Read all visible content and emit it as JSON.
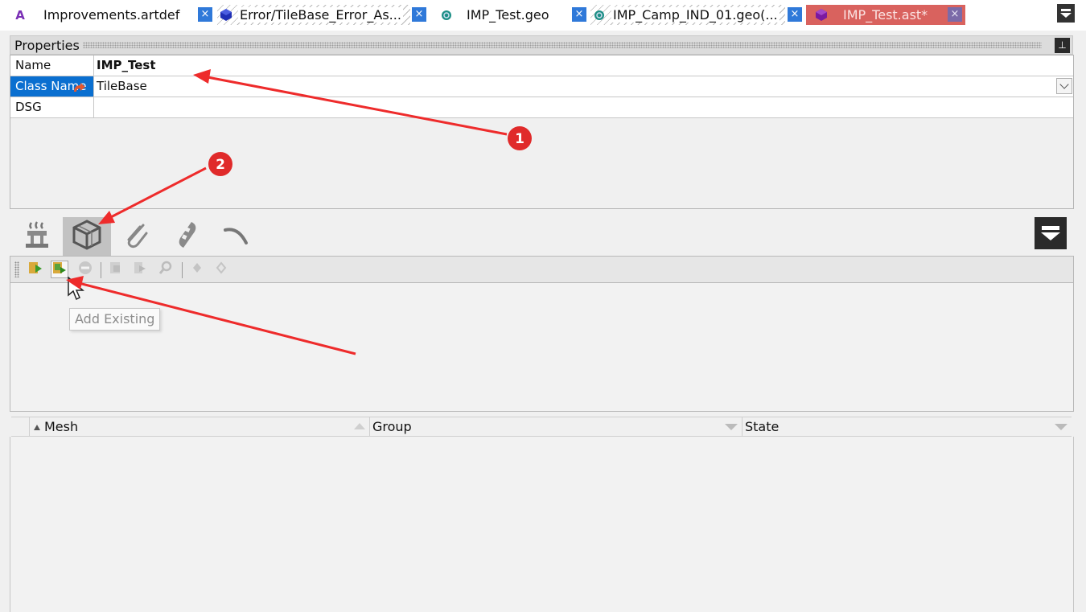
{
  "tabs": [
    {
      "label": "Improvements.artdef",
      "icon": "letter-a-icon",
      "icon_glyph": "A",
      "style": "normal"
    },
    {
      "label": "Error/TileBase_Error_As...",
      "icon": "cube-icon",
      "style": "hatched"
    },
    {
      "label": "IMP_Test.geo",
      "icon": "geo-icon",
      "style": "normal"
    },
    {
      "label": "IMP_Camp_IND_01.geo(...",
      "icon": "geo-icon",
      "style": "hatched"
    },
    {
      "label": "IMP_Test.ast*",
      "icon": "cube-icon",
      "style": "active"
    }
  ],
  "close_glyph": "×",
  "properties": {
    "title": "Properties",
    "pin_glyph": "⊥",
    "rows": [
      {
        "name": "Name",
        "value": "IMP_Test"
      },
      {
        "name": "Class Name",
        "value": "TileBase"
      },
      {
        "name": "DSG",
        "value": ""
      }
    ]
  },
  "icon_tabs": [
    {
      "icon": "fountain-icon"
    },
    {
      "icon": "mesh-cube-icon",
      "active": true
    },
    {
      "icon": "paperclip-icon"
    },
    {
      "icon": "film-strip-icon"
    },
    {
      "icon": "curve-icon"
    }
  ],
  "toolbar": {
    "buttons": [
      {
        "icon": "add-new-icon"
      },
      {
        "icon": "add-existing-icon"
      },
      {
        "icon": "remove-icon"
      },
      {
        "icon": "import-icon"
      },
      {
        "icon": "export-icon"
      },
      {
        "icon": "search-icon"
      },
      {
        "icon": "attach-icon"
      },
      {
        "icon": "detach-icon"
      }
    ]
  },
  "tooltip": {
    "text": "Add Existing"
  },
  "columns": [
    {
      "label": "Mesh"
    },
    {
      "label": "Group"
    },
    {
      "label": "State"
    }
  ],
  "annotations": {
    "arrow_color": "#ee2b2b",
    "badges": [
      "1",
      "2"
    ]
  }
}
